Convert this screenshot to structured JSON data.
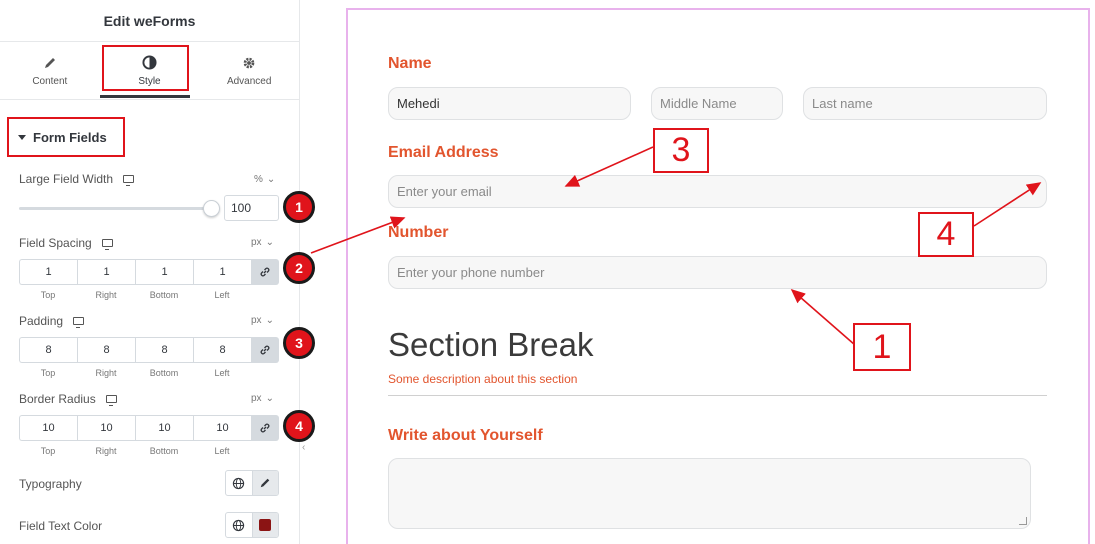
{
  "panel": {
    "title": "Edit weForms",
    "tabs": [
      {
        "label": "Content",
        "icon": "pencil-icon"
      },
      {
        "label": "Style",
        "icon": "contrast-icon"
      },
      {
        "label": "Advanced",
        "icon": "gear-icon"
      }
    ],
    "section": "Form Fields",
    "large_field_width": {
      "label": "Large Field Width",
      "unit": "%",
      "value": "100",
      "slider_fraction": 1.0
    },
    "field_spacing": {
      "label": "Field Spacing",
      "unit": "px",
      "values": [
        "1",
        "1",
        "1",
        "1"
      ]
    },
    "padding": {
      "label": "Padding",
      "unit": "px",
      "values": [
        "8",
        "8",
        "8",
        "8"
      ]
    },
    "border_radius": {
      "label": "Border Radius",
      "unit": "px",
      "values": [
        "10",
        "10",
        "10",
        "10"
      ]
    },
    "dim_labels": [
      "Top",
      "Right",
      "Bottom",
      "Left"
    ],
    "typography": {
      "label": "Typography"
    },
    "field_text_color": {
      "label": "Field Text Color",
      "color": "#8b1414"
    },
    "badges": [
      "1",
      "2",
      "3",
      "4"
    ]
  },
  "form": {
    "name_label": "Name",
    "first_name_value": "Mehedi",
    "middle_name_placeholder": "Middle Name",
    "last_name_placeholder": "Last name",
    "email_label": "Email Address",
    "email_placeholder": "Enter your email",
    "number_label": "Number",
    "number_placeholder": "Enter your phone number",
    "section_break_title": "Section Break",
    "section_break_desc": "Some description about this section",
    "about_label": "Write about Yourself"
  },
  "callouts": [
    "3",
    "4",
    "1"
  ],
  "colors": {
    "accent": "#e0141b",
    "label": "#e2552e",
    "preview_border": "#e8b2ec"
  }
}
